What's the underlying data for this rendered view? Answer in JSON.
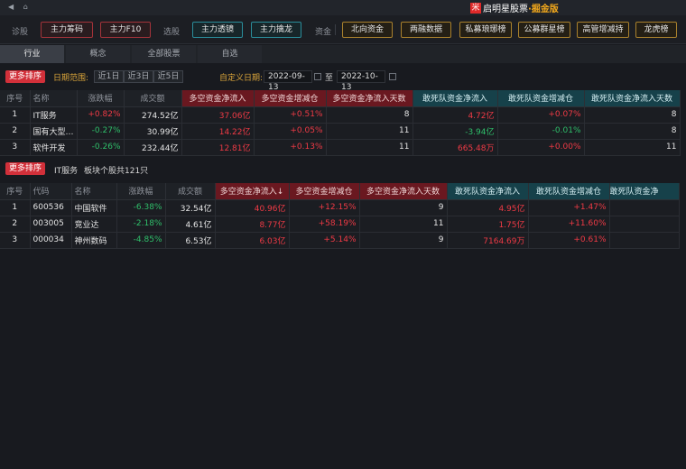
{
  "titlebar": {
    "nav_back": "◀",
    "nav_home": "⌂",
    "logo_glyph": "米",
    "brand_main": "启明星股票",
    "brand_sub": "·掘金版"
  },
  "toolbar": {
    "group1_label": "诊股",
    "btn_zhuli_choumao": "主力筹码",
    "btn_zhuli_f10": "主力F10",
    "group2_label": "选股",
    "btn_zhuli_toujing": "主力透镜",
    "btn_zhuli_qinlong": "主力擒龙",
    "group3_label": "资金",
    "btn_beixiang": "北向资金",
    "btn_rongzi": "两融数据",
    "btn_simu": "私募琅琊榜",
    "btn_gongmu": "公募群星榜",
    "btn_gaoguan": "高管增减持",
    "btn_longhu": "龙虎榜"
  },
  "tabs": [
    "行业",
    "概念",
    "全部股票",
    "自选"
  ],
  "filter": {
    "more_sort": "更多排序",
    "date_range_label": "日期范围:",
    "ranges": [
      "近1日",
      "近3日",
      "近5日"
    ],
    "custom_label": "自定义日期:",
    "start_date": "2022-09-13",
    "to": "至",
    "end_date": "2022-10-13"
  },
  "industry_table": {
    "headers": [
      "序号",
      "名称",
      "涨跌幅",
      "成交额",
      "多空资金净流入",
      "多空资金增减仓",
      "多空资金净流入天数",
      "敢死队资金净流入",
      "敢死队资金增减仓",
      "敢死队资金净流入天数"
    ],
    "rows": [
      {
        "idx": "1",
        "name": "IT服务",
        "chg": "+0.82%",
        "amt": "274.52亿",
        "dk_in": "37.06亿",
        "dk_pos": "+0.51%",
        "dk_days": "8",
        "gs_in": "4.72亿",
        "gs_pos": "+0.07%",
        "gs_days": "8"
      },
      {
        "idx": "2",
        "name": "国有大型…",
        "chg": "-0.27%",
        "amt": "30.99亿",
        "dk_in": "14.22亿",
        "dk_pos": "+0.05%",
        "dk_days": "11",
        "gs_in": "-3.94亿",
        "gs_pos": "-0.01%",
        "gs_days": "8"
      },
      {
        "idx": "3",
        "name": "软件开发",
        "chg": "-0.26%",
        "amt": "232.44亿",
        "dk_in": "12.81亿",
        "dk_pos": "+0.13%",
        "dk_days": "11",
        "gs_in": "665.48万",
        "gs_pos": "+0.00%",
        "gs_days": "11"
      }
    ]
  },
  "section2": {
    "more_sort": "更多排序",
    "sector": "IT服务",
    "count_text": "板块个股共121只"
  },
  "stock_table": {
    "headers": [
      "序号",
      "代码",
      "名称",
      "涨跌幅",
      "成交额",
      "多空资金净流入↓",
      "多空资金增减仓",
      "多空资金净流入天数",
      "敢死队资金净流入",
      "敢死队资金增减仓",
      "敢死队资金净"
    ],
    "rows": [
      {
        "idx": "1",
        "code": "600536",
        "name": "中国软件",
        "chg": "-6.38%",
        "amt": "32.54亿",
        "dk_in": "40.96亿",
        "dk_pos": "+12.15%",
        "dk_days": "9",
        "gs_in": "4.95亿",
        "gs_pos": "+1.47%"
      },
      {
        "idx": "2",
        "code": "003005",
        "name": "竞业达",
        "chg": "-2.18%",
        "amt": "4.61亿",
        "dk_in": "8.77亿",
        "dk_pos": "+58.19%",
        "dk_days": "11",
        "gs_in": "1.75亿",
        "gs_pos": "+11.60%"
      },
      {
        "idx": "3",
        "code": "000034",
        "name": "神州数码",
        "chg": "-4.85%",
        "amt": "6.53亿",
        "dk_in": "6.03亿",
        "dk_pos": "+5.14%",
        "dk_days": "9",
        "gs_in": "7164.69万",
        "gs_pos": "+0.61%"
      }
    ]
  },
  "colors": {
    "up": "#ef3a45",
    "down": "#2fbf6a",
    "header_red": "#6a1820",
    "header_teal": "#16414a",
    "accent": "#d2303a"
  }
}
